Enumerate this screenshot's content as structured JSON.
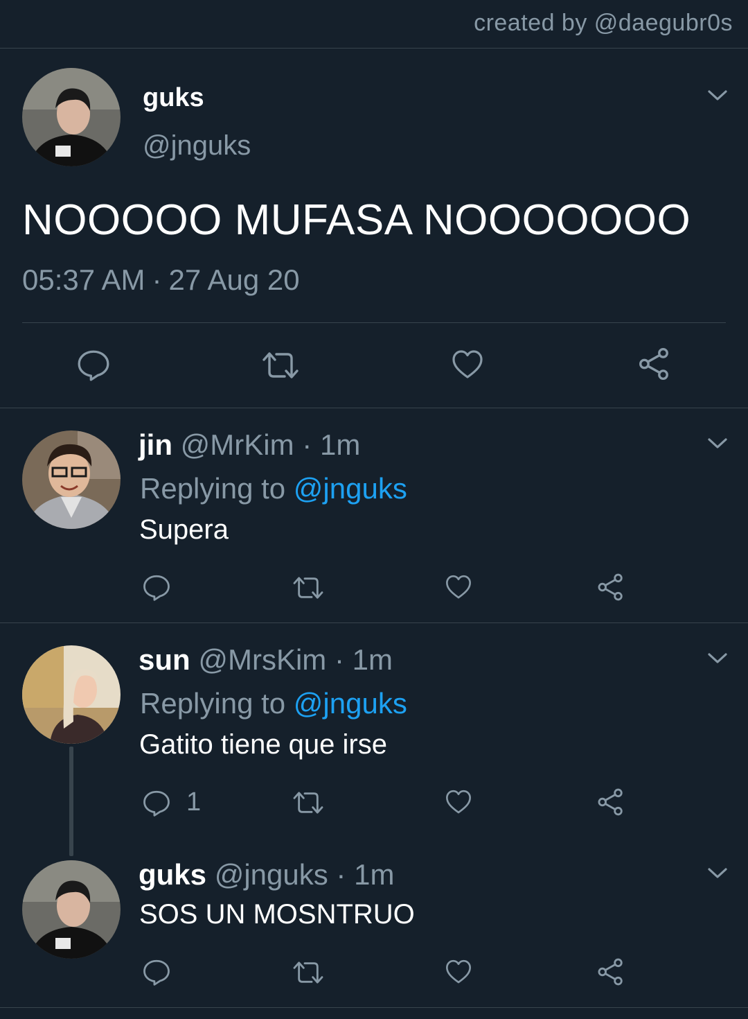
{
  "credit": "created by @daegubr0s",
  "main_tweet": {
    "name": "guks",
    "handle": "@jnguks",
    "text": "NOOOOO MUFASA NOOOOOOO",
    "time": "05:37 AM",
    "date": "27 Aug 20",
    "separator": "·"
  },
  "replies": [
    {
      "name": "jin",
      "handle": "@MrKim",
      "time": "1m",
      "replying_label": "Replying to",
      "replying_to": "@jnguks",
      "text": "Supera",
      "reply_count": ""
    },
    {
      "name": "sun",
      "handle": "@MrsKim",
      "time": "1m",
      "replying_label": "Replying to",
      "replying_to": "@jnguks",
      "text": "Gatito tiene que irse",
      "reply_count": "1"
    },
    {
      "name": "guks",
      "handle": "@jnguks",
      "time": "1m",
      "text": "SOS UN MOSNTRUO",
      "reply_count": ""
    }
  ],
  "colors": {
    "background": "#15202b",
    "muted": "#8899a6",
    "link": "#1da1f2",
    "divider": "#38444d"
  },
  "icons": [
    "chevron-down-icon",
    "reply-icon",
    "retweet-icon",
    "like-icon",
    "share-icon"
  ]
}
